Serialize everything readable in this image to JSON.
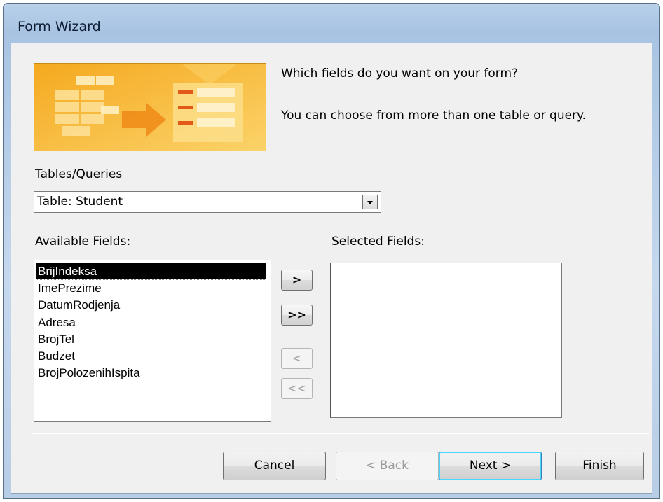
{
  "window": {
    "title": "Form Wizard"
  },
  "intro": {
    "question": "Which fields do you want on your form?",
    "hint": "You can choose from more than one table or query."
  },
  "tables_queries": {
    "label_mnemonic": "T",
    "label_rest": "ables/Queries",
    "value": "Table: Student"
  },
  "available_fields": {
    "label_mnemonic": "A",
    "label_rest": "vailable Fields:",
    "items": [
      "BrijIndeksa",
      "ImePrezime",
      "DatumRodjenja",
      "Adresa",
      "BrojTel",
      "Budzet",
      "BrojPolozenihIspita"
    ],
    "selected_index": 0
  },
  "selected_fields": {
    "label_mnemonic": "S",
    "label_rest": "elected Fields:",
    "items": []
  },
  "move_buttons": {
    "add_one": ">",
    "add_all": ">>",
    "remove_one": "<",
    "remove_all": "<<"
  },
  "footer": {
    "cancel": "Cancel",
    "back_prefix": "< ",
    "back_mnemonic": "B",
    "back_rest": "ack",
    "next_mnemonic": "N",
    "next_rest": "ext >",
    "finish_mnemonic": "F",
    "finish_rest": "inish"
  },
  "colors": {
    "illustration_bg": "#f7b733",
    "selection_bg": "#000000",
    "disabled_text": "#9a9a9a"
  }
}
